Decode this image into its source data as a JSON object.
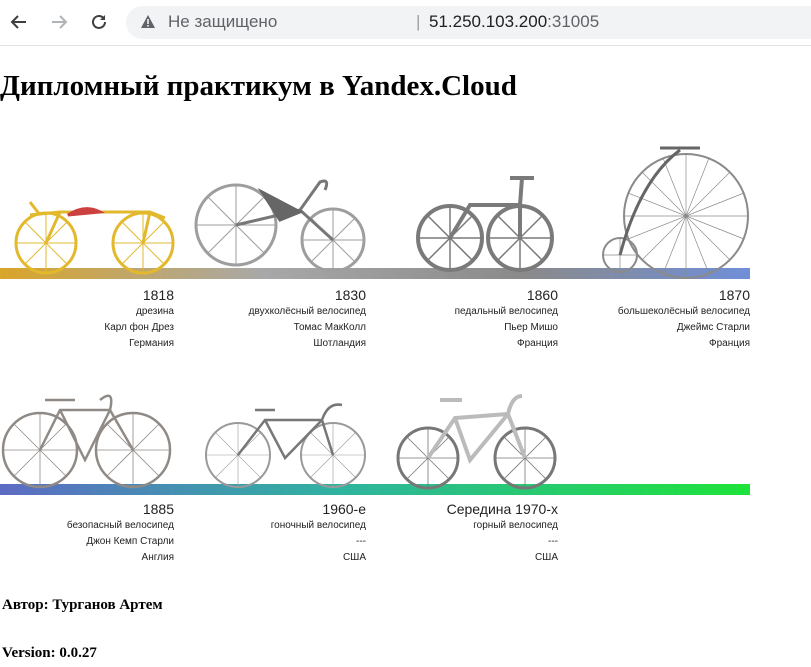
{
  "browser": {
    "insecure_label": "Не защищено",
    "separator": "|",
    "url_host": "51.250.103.200",
    "url_port": ":31005"
  },
  "page": {
    "title": "Дипломный практикум в Yandex.Cloud",
    "author": "Автор: Турганов Артем",
    "version": "Version: 0.0.27"
  },
  "timeline": [
    {
      "year": "1818",
      "type": "дрезина",
      "inventor": "Карл фон Дрез",
      "country": "Германия"
    },
    {
      "year": "1830",
      "type": "двухколёсный велосипед",
      "inventor": "Томас МакКолл",
      "country": "Шотландия"
    },
    {
      "year": "1860",
      "type": "педальный велосипед",
      "inventor": "Пьер Мишо",
      "country": "Франция"
    },
    {
      "year": "1870",
      "type": "большеколёсный велосипед",
      "inventor": "Джеймс Старли",
      "country": "Франция"
    },
    {
      "year": "1885",
      "type": "безопасный велосипед",
      "inventor": "Джон Кемп Старли",
      "country": "Англия"
    },
    {
      "year": "1960-е",
      "type": "гоночный велосипед",
      "inventor": "---",
      "country": "США"
    },
    {
      "year": "Середина 1970-х",
      "type": "горный велосипед",
      "inventor": "---",
      "country": "США"
    }
  ],
  "colors": {
    "row1_start": "#d9a52a",
    "row1_mid": "#9a9a9a",
    "row1_end": "#6f8fd8",
    "row2_start": "#5d6bc4",
    "row2_mid": "#2fb3a0",
    "row2_end": "#1ee33a"
  }
}
